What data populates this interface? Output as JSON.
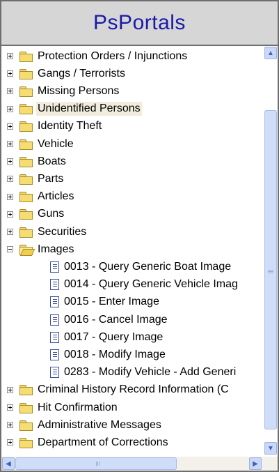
{
  "header": {
    "title": "PsPortals"
  },
  "tree": [
    {
      "label": "Protection Orders / Injunctions",
      "type": "folder",
      "expanded": false
    },
    {
      "label": "Gangs / Terrorists",
      "type": "folder",
      "expanded": false
    },
    {
      "label": "Missing Persons",
      "type": "folder",
      "expanded": false
    },
    {
      "label": "Unidentified Persons",
      "type": "folder",
      "expanded": false,
      "selected": true
    },
    {
      "label": "Identity Theft",
      "type": "folder",
      "expanded": false
    },
    {
      "label": "Vehicle",
      "type": "folder",
      "expanded": false
    },
    {
      "label": "Boats",
      "type": "folder",
      "expanded": false
    },
    {
      "label": "Parts",
      "type": "folder",
      "expanded": false
    },
    {
      "label": "Articles",
      "type": "folder",
      "expanded": false
    },
    {
      "label": "Guns",
      "type": "folder",
      "expanded": false
    },
    {
      "label": "Securities",
      "type": "folder",
      "expanded": false
    },
    {
      "label": "Images",
      "type": "folder",
      "expanded": true
    },
    {
      "label": "0013 - Query Generic Boat Image",
      "type": "doc"
    },
    {
      "label": "0014 - Query Generic Vehicle Imag",
      "type": "doc"
    },
    {
      "label": "0015 - Enter Image",
      "type": "doc"
    },
    {
      "label": "0016 - Cancel Image",
      "type": "doc"
    },
    {
      "label": "0017 - Query  Image",
      "type": "doc"
    },
    {
      "label": "0018 - Modify Image",
      "type": "doc"
    },
    {
      "label": "0283 - Modify Vehicle - Add Generi",
      "type": "doc"
    },
    {
      "label": "Criminal History Record Information (C",
      "type": "folder",
      "expanded": false
    },
    {
      "label": "Hit Confirmation",
      "type": "folder",
      "expanded": false
    },
    {
      "label": "Administrative Messages",
      "type": "folder",
      "expanded": false
    },
    {
      "label": "Department of Corrections",
      "type": "folder",
      "expanded": false
    }
  ],
  "colors": {
    "title": "#1a1aa8",
    "header_bg": "#d6d6d6",
    "selection": "#f1ecdc"
  },
  "icons": {
    "expand": "plus-box-icon",
    "collapse": "minus-box-icon",
    "folder": "folder-icon",
    "folder_open": "open-folder-icon",
    "document": "document-icon",
    "scroll_up": "up-arrow-icon",
    "scroll_down": "down-arrow-icon",
    "scroll_left": "left-arrow-icon",
    "scroll_right": "right-arrow-icon"
  }
}
